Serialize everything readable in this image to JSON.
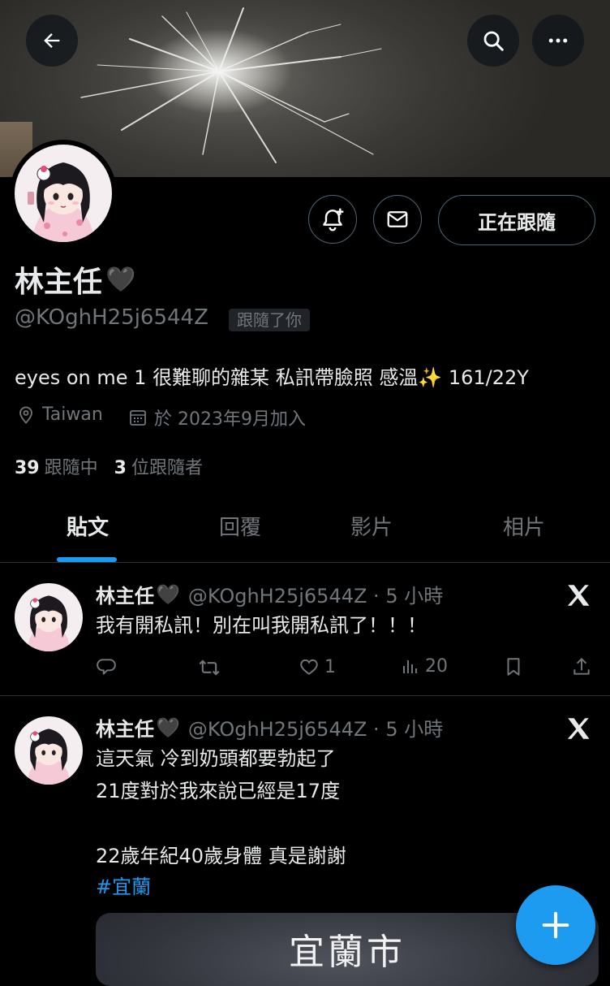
{
  "profile": {
    "name": "林主任",
    "name_emoji": "🖤",
    "handle": "@KOghH25j6544Z",
    "follows_you": "跟隨了你",
    "bio": "eyes on me 1 很難聊的雜某 私訊帶臉照 感溫✨ 161/22Y",
    "location": "Taiwan",
    "joined": "於 2023年9月加入",
    "following_count": "39",
    "following_label": "跟隨中",
    "followers_count": "3",
    "followers_label": "位跟隨者",
    "follow_button": "正在跟隨"
  },
  "tabs": [
    "貼文",
    "回覆",
    "影片",
    "相片"
  ],
  "posts": [
    {
      "name": "林主任",
      "name_emoji": "🖤",
      "meta": "@KOghH25j6544Z · 5 小時",
      "text": "我有開私訊！別在叫我開私訊了！！！",
      "likes": "1",
      "views": "20"
    },
    {
      "name": "林主任",
      "name_emoji": "🖤",
      "meta": "@KOghH25j6544Z · 5 小時",
      "text": "這天氣 冷到奶頭都要勃起了\n21度對於我來說已經是17度\n\n22歲年紀40歲身體 真是謝謝",
      "hashtag": "#宜蘭",
      "media_title": "宜蘭市"
    }
  ],
  "colors": {
    "accent": "#1d9bf0",
    "text_primary": "#e7e9ea",
    "text_secondary": "#71767b",
    "border": "#2f3336"
  },
  "icons": [
    "back-arrow-icon",
    "search-icon",
    "more-icon",
    "bell-plus-icon",
    "mail-icon",
    "location-pin-icon",
    "calendar-icon",
    "x-logo-icon",
    "reply-icon",
    "retweet-icon",
    "heart-icon",
    "views-icon",
    "bookmark-icon",
    "share-icon",
    "plus-icon"
  ]
}
